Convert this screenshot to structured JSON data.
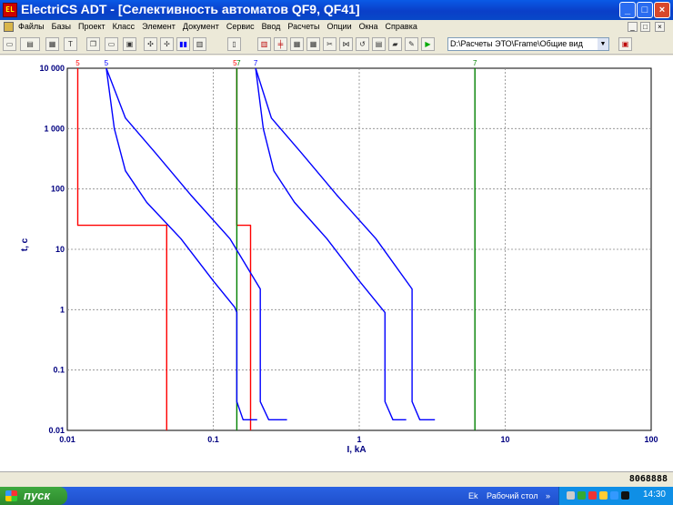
{
  "window": {
    "app_icon_text": "EL",
    "title": "ElectriCS ADT - [Селективность автоматов QF9, QF41]",
    "minimize": "_",
    "maximize": "□",
    "close": "×"
  },
  "menu": {
    "items": [
      "Файлы",
      "Базы",
      "Проект",
      "Класс",
      "Элемент",
      "Документ",
      "Сервис",
      "Ввод",
      "Расчеты",
      "Опции",
      "Окна",
      "Справка"
    ],
    "mdi_min": "_",
    "mdi_restore": "□",
    "mdi_close": "×"
  },
  "toolbar": {
    "path_value": "D:\\Расчеты ЭТО\\Frame\\Общие вид",
    "dropdown_arrow": "▼"
  },
  "chart_data": {
    "type": "line",
    "x_scale": "log",
    "y_scale": "log",
    "xlim": [
      0.01,
      100
    ],
    "ylim": [
      0.01,
      10000
    ],
    "xlabel": "I, kA",
    "ylabel": "t, c",
    "x_ticks": [
      "0.01",
      "0.1",
      "1",
      "10",
      "100"
    ],
    "y_ticks": [
      "10 000",
      "1 000",
      "100",
      "10",
      "1",
      "0.1",
      "0.01"
    ],
    "grid": true,
    "top_markers": [
      {
        "label": "5",
        "x": 0.0118,
        "color": "#ff0000"
      },
      {
        "label": "5",
        "x": 0.0185,
        "color": "#0000ff"
      },
      {
        "label": "5",
        "x": 0.145,
        "color": "#ff0000"
      },
      {
        "label": "7",
        "x": 0.145,
        "color": "#008000"
      },
      {
        "label": "7",
        "x": 0.195,
        "color": "#0000ff"
      },
      {
        "label": "7",
        "x": 6.2,
        "color": "#008000"
      }
    ],
    "series": [
      {
        "color": "#ff0000",
        "points": [
          [
            0.0118,
            10000
          ],
          [
            0.0118,
            25
          ],
          [
            0.048,
            25
          ],
          [
            0.048,
            0.01
          ]
        ]
      },
      {
        "color": "#ff0000",
        "points": [
          [
            0.145,
            10000
          ],
          [
            0.145,
            25
          ],
          [
            0.18,
            25
          ],
          [
            0.18,
            0.01
          ]
        ]
      },
      {
        "color": "#008000",
        "points": [
          [
            0.145,
            10000
          ],
          [
            0.145,
            0.01
          ]
        ]
      },
      {
        "color": "#008000",
        "points": [
          [
            6.2,
            10000
          ],
          [
            6.2,
            0.01
          ]
        ]
      },
      {
        "color": "#0000ff",
        "points": [
          [
            0.0185,
            10000
          ],
          [
            0.021,
            1000
          ],
          [
            0.025,
            200
          ],
          [
            0.035,
            60
          ],
          [
            0.06,
            15
          ],
          [
            0.1,
            3
          ],
          [
            0.14,
            1.1
          ],
          [
            0.145,
            0.9
          ],
          [
            0.145,
            0.03
          ],
          [
            0.16,
            0.015
          ],
          [
            0.2,
            0.015
          ]
        ]
      },
      {
        "color": "#0000ff",
        "points": [
          [
            0.0185,
            10000
          ],
          [
            0.025,
            1500
          ],
          [
            0.04,
            400
          ],
          [
            0.07,
            80
          ],
          [
            0.13,
            15
          ],
          [
            0.21,
            2.2
          ],
          [
            0.21,
            0.03
          ],
          [
            0.24,
            0.015
          ],
          [
            0.32,
            0.015
          ]
        ]
      },
      {
        "color": "#0000ff",
        "points": [
          [
            0.195,
            10000
          ],
          [
            0.22,
            1000
          ],
          [
            0.26,
            200
          ],
          [
            0.36,
            60
          ],
          [
            0.6,
            15
          ],
          [
            1.0,
            3
          ],
          [
            1.4,
            1.1
          ],
          [
            1.5,
            0.9
          ],
          [
            1.5,
            0.03
          ],
          [
            1.7,
            0.015
          ],
          [
            2.1,
            0.015
          ]
        ]
      },
      {
        "color": "#0000ff",
        "points": [
          [
            0.195,
            10000
          ],
          [
            0.25,
            1500
          ],
          [
            0.4,
            400
          ],
          [
            0.7,
            80
          ],
          [
            1.3,
            15
          ],
          [
            2.3,
            2.2
          ],
          [
            2.3,
            0.03
          ],
          [
            2.6,
            0.015
          ],
          [
            3.3,
            0.015
          ]
        ]
      }
    ]
  },
  "statusbar": {
    "code": "8068888"
  },
  "taskbar": {
    "start_label": "пуск",
    "app_task": "Ek",
    "desktop_label": "Рабочий стол",
    "desktop_arrow": "»",
    "clock": "14:30"
  }
}
